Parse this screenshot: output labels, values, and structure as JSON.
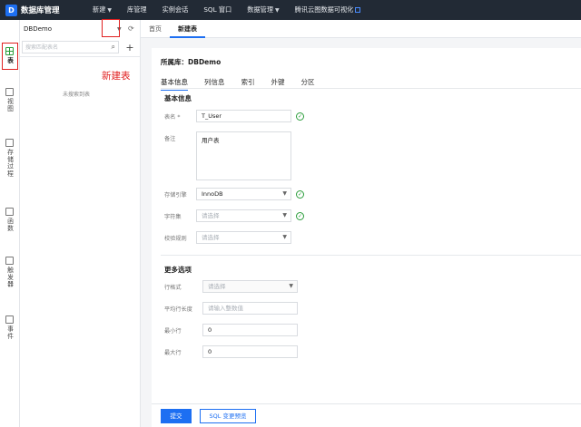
{
  "app": {
    "title": "数据库管理",
    "logo_letter": "D"
  },
  "nav": [
    {
      "label": "新建",
      "has_dropdown": true
    },
    {
      "label": "库管理",
      "has_dropdown": false
    },
    {
      "label": "实例会话",
      "has_dropdown": false
    },
    {
      "label": "SQL 窗口",
      "has_dropdown": false
    },
    {
      "label": "数据管理",
      "has_dropdown": true
    },
    {
      "label": "腾讯云图数据可视化",
      "has_dropdown": false,
      "external": true
    }
  ],
  "rail": [
    {
      "label": "表",
      "icon": "table-icon",
      "active": true
    },
    {
      "label": "视图",
      "icon": "view-icon"
    },
    {
      "label": "存储过程",
      "icon": "procedure-icon"
    },
    {
      "label": "函数",
      "icon": "function-icon"
    },
    {
      "label": "触发器",
      "icon": "trigger-icon"
    },
    {
      "label": "事件",
      "icon": "event-icon"
    }
  ],
  "tree": {
    "db_name": "DBDemo",
    "search_placeholder": "搜索匹配表名",
    "empty_text": "未搜索到表",
    "add_label": "+",
    "annotation": "新建表"
  },
  "tabs": [
    {
      "label": "首页",
      "active": false
    },
    {
      "label": "新建表",
      "active": true
    }
  ],
  "form": {
    "db_title": "所属库：DBDemo",
    "subtabs": [
      {
        "label": "基本信息",
        "active": true
      },
      {
        "label": "列信息"
      },
      {
        "label": "索引"
      },
      {
        "label": "外键"
      },
      {
        "label": "分区"
      }
    ],
    "basic_section": "基本信息",
    "table_name_label": "表名 *",
    "table_name_value": "T_User",
    "comment_label": "备注",
    "comment_value": "用户表",
    "engine_label": "存储引擎",
    "engine_value": "InnoDB",
    "charset_label": "字符集",
    "charset_placeholder": "请选择",
    "collation_label": "校验规则",
    "collation_placeholder": "请选择",
    "more_section": "更多选项",
    "row_format_label": "行格式",
    "row_format_placeholder": "请选择",
    "avg_row_label": "平均行长度",
    "avg_row_placeholder": "请输入整数值",
    "min_rows_label": "最小行",
    "min_rows_value": "0",
    "max_rows_label": "最大行",
    "max_rows_value": "0"
  },
  "footer": {
    "submit_label": "提交",
    "preview_label": "SQL 变更预览"
  },
  "colors": {
    "accent": "#1d6ff2",
    "topbar": "#222a35",
    "success": "#2a9d3a",
    "annotation": "#e02020"
  }
}
